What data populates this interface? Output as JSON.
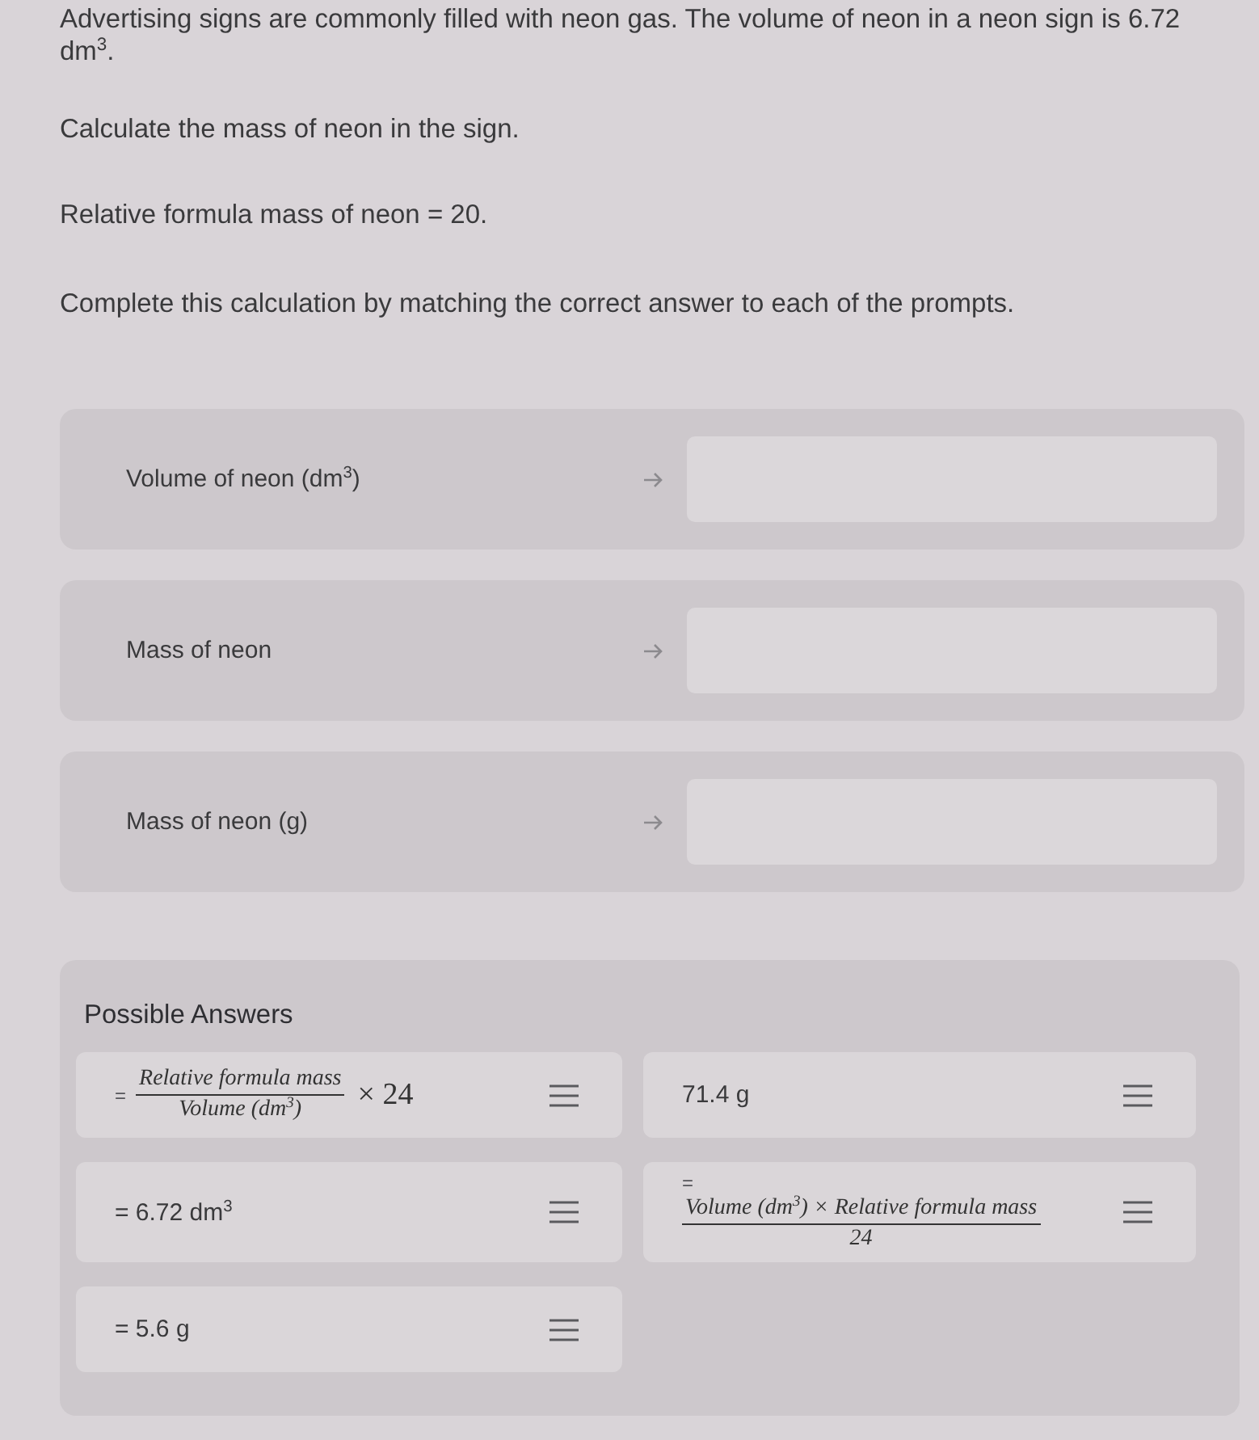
{
  "question": {
    "paragraphs": [
      "Advertising signs are commonly filled with neon gas. The volume of neon in a neon sign is 6.72 dm$^{3}$.",
      "Calculate the mass of neon in the sign.",
      "Relative formula mass of neon = 20.",
      "Complete this calculation by matching the correct answer to each of the prompts."
    ]
  },
  "prompts": [
    {
      "label": "Volume of neon (dm$^{3}$)"
    },
    {
      "label": "Mass of neon"
    },
    {
      "label": "Mass of neon (g)"
    }
  ],
  "answers_panel": {
    "title": "Possible Answers",
    "answers": [
      {
        "kind": "fraction",
        "prefix": "=",
        "numerator": "Relative formula mass",
        "denominator": "Volume (dm$^{3}$)",
        "suffix": "× 24"
      },
      {
        "kind": "text",
        "text": "71.4 g"
      },
      {
        "kind": "text",
        "text": "= 6.72 dm$^{3}$"
      },
      {
        "kind": "display",
        "prefix": "=",
        "numerator": "Volume (dm$^{3}$) × Relative formula mass",
        "denominator": "24"
      },
      {
        "kind": "text",
        "text": "= 5.6 g"
      }
    ]
  }
}
